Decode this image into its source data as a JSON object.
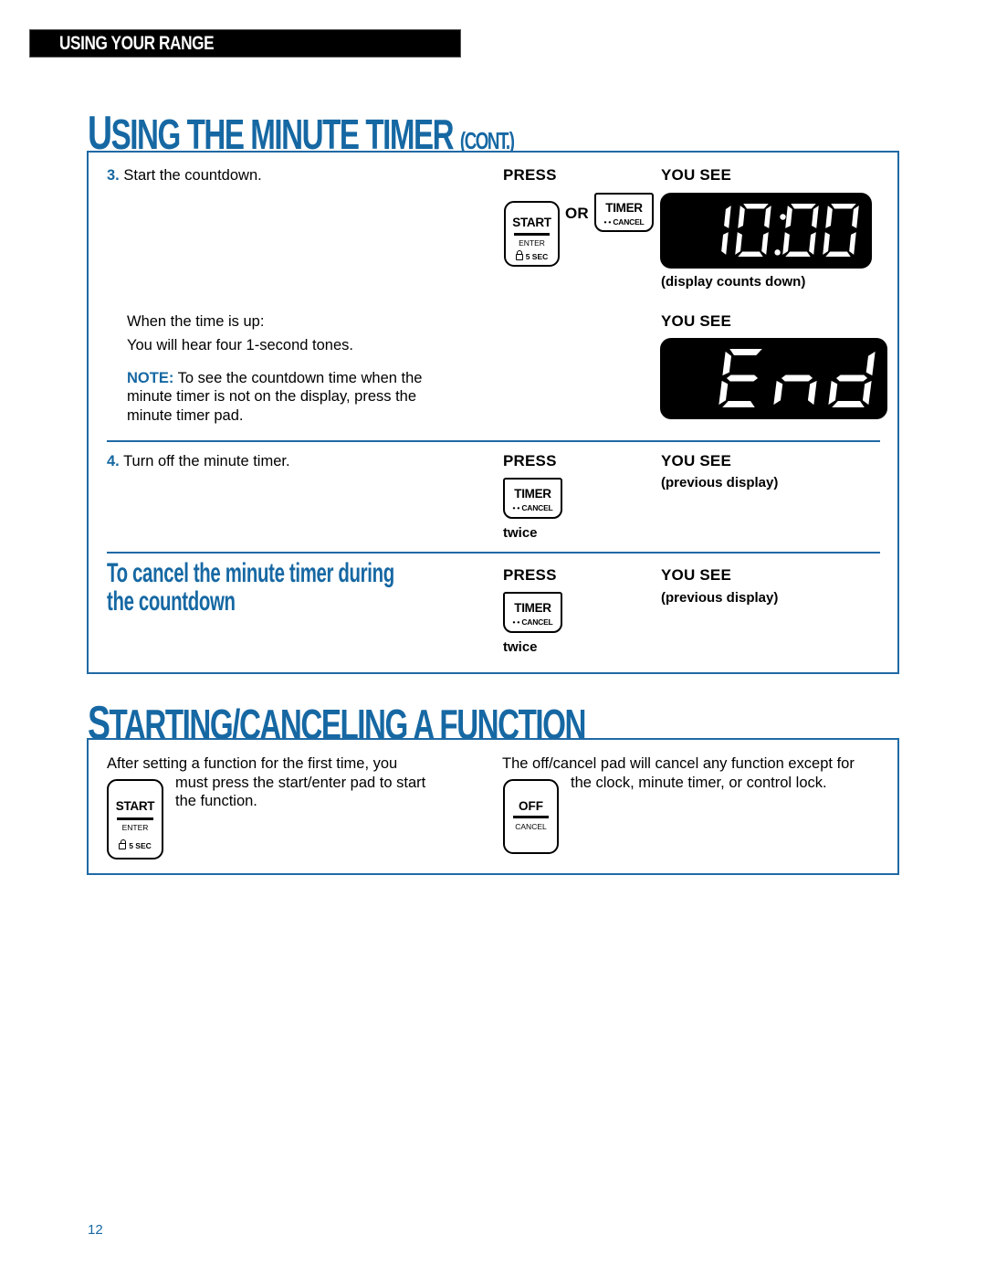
{
  "section_bar": {
    "label": "USING YOUR RANGE"
  },
  "title1": {
    "lead": "U",
    "rest": "SING THE MINUTE TIMER",
    "cont": "(CONT.)"
  },
  "step3": {
    "number": "3.",
    "text": "Start the countdown.",
    "press_header": "PRESS",
    "you_see_header": "YOU SEE",
    "or_label": "OR",
    "display_value": "10:00",
    "display_caption": "(display counts down)"
  },
  "time_up": {
    "line1": "When the time is up:",
    "line2": "You will hear four 1-second tones.",
    "you_see_header": "YOU SEE",
    "display_value": "End",
    "note_label": "NOTE:",
    "note_lines": [
      "To see the countdown time when the",
      "minute timer is not on the display, press the",
      "minute timer pad."
    ]
  },
  "step4": {
    "number": "4.",
    "text": "Turn off the minute timer.",
    "press_header": "PRESS",
    "you_see_header": "YOU SEE",
    "result": "(previous display)",
    "press_count": "twice"
  },
  "cancel_countdown": {
    "heading_line1": "To cancel the minute timer during",
    "heading_line2": "the countdown",
    "press_header": "PRESS",
    "you_see_header": "YOU SEE",
    "result": "(previous display)",
    "press_count": "twice"
  },
  "title2": {
    "lead": "S",
    "rest": "TARTING/CANCELING A FUNCTION"
  },
  "function_box": {
    "left_lines": [
      "After setting a function for the first time, you",
      "must press the start/enter pad to start",
      "the function."
    ],
    "right_lines": [
      "The off/cancel pad will cancel any function except for",
      "the clock, minute timer, or control lock."
    ]
  },
  "keypads": {
    "start": {
      "main": "START",
      "sub": "ENTER",
      "lock": "5 SEC"
    },
    "timer": {
      "main": "TIMER",
      "sub": "• • CANCEL"
    },
    "off": {
      "main": "OFF",
      "sub": "CANCEL"
    }
  },
  "page_number": "12",
  "colors": {
    "accent": "#1668a3",
    "border": "#1f6aa5",
    "display_bg": "#000000"
  }
}
